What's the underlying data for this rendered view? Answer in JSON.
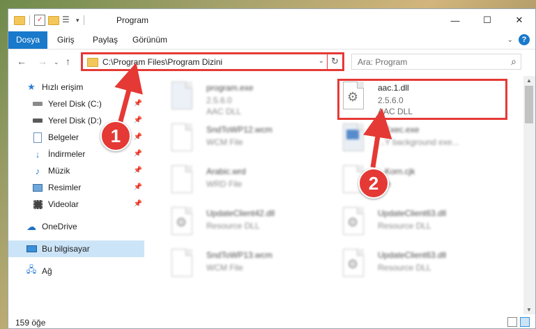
{
  "window": {
    "title": "Program"
  },
  "ribbon": {
    "tabs": [
      {
        "label": "Dosya"
      },
      {
        "label": "Giriş"
      },
      {
        "label": "Paylaş"
      },
      {
        "label": "Görünüm"
      }
    ]
  },
  "nav": {
    "address": "C:\\Program Files\\Program Dizini",
    "search_placeholder": "Ara: Program"
  },
  "sidebar": {
    "items": [
      {
        "label": "Hızlı erişim",
        "icon": "star-icon"
      },
      {
        "label": "Yerel Disk (C:)",
        "icon": "drive-icon"
      },
      {
        "label": "Yerel Disk (D:)",
        "icon": "drive-icon"
      },
      {
        "label": "Belgeler",
        "icon": "documents-icon"
      },
      {
        "label": "İndirmeler",
        "icon": "download-icon"
      },
      {
        "label": "Müzik",
        "icon": "music-icon"
      },
      {
        "label": "Resimler",
        "icon": "pictures-icon"
      },
      {
        "label": "Videolar",
        "icon": "videos-icon"
      },
      {
        "label": "OneDrive",
        "icon": "cloud-icon"
      },
      {
        "label": "Bu bilgisayar",
        "icon": "computer-icon"
      },
      {
        "label": "Ağ",
        "icon": "network-icon"
      }
    ]
  },
  "files": [
    {
      "name": "program.exe",
      "l2": "2.5.6.0",
      "l3": "AAC DLL",
      "blurred": true
    },
    {
      "name": "aac.1.dll",
      "l2": "2.5.6.0",
      "l3": "AAC DLL",
      "blurred": false
    },
    {
      "name": "SndToWP12.wcm",
      "l2": "WCM File",
      "l3": "",
      "blurred": true
    },
    {
      "name": "...Exec.exe",
      "l2": "...Y background exe...",
      "l3": "",
      "blurred": true
    },
    {
      "name": "Arabic.wrd",
      "l2": "WRD File",
      "l3": "",
      "blurred": true
    },
    {
      "name": "...Korn.cjk",
      "l2": "...le",
      "l3": "",
      "blurred": true
    },
    {
      "name": "UpdateClient42.dll",
      "l2": "Resource DLL",
      "l3": "",
      "blurred": true
    },
    {
      "name": "UpdateClient63.dll",
      "l2": "Resource DLL",
      "l3": "",
      "blurred": true
    },
    {
      "name": "SndToWP13.wcm",
      "l2": "WCM File",
      "l3": "",
      "blurred": true
    },
    {
      "name": "UpdateClient63.dll",
      "l2": "Resource DLL",
      "l3": "",
      "blurred": true
    }
  ],
  "status": {
    "count": "159 öğe"
  },
  "markers": [
    "1",
    "2"
  ],
  "colors": {
    "accent": "#1979ca",
    "highlight": "#e53935",
    "selection": "#cce4f7"
  }
}
